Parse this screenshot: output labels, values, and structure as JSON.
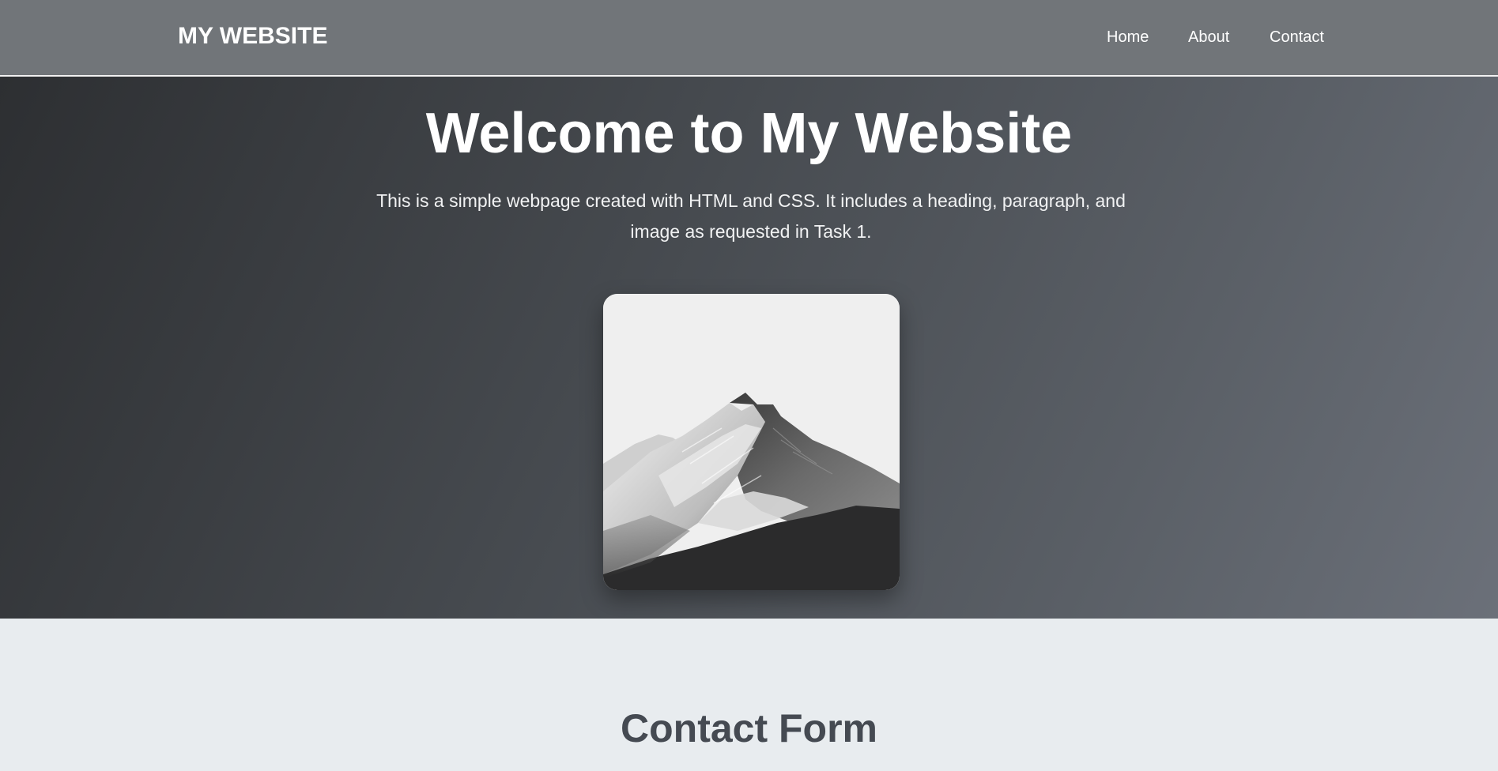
{
  "header": {
    "logo": "MY WEBSITE",
    "nav": {
      "home": "Home",
      "about": "About",
      "contact": "Contact"
    }
  },
  "hero": {
    "title": "Welcome to My Website",
    "text": "This is a simple webpage created with HTML and CSS. It includes a heading, paragraph, and image as requested in Task 1.",
    "image_icon": "mountain-landscape-image"
  },
  "contact": {
    "title": "Contact Form"
  },
  "colors": {
    "header_bg": "#717579",
    "hero_dark": "#2d2f32",
    "hero_light": "#6b7079",
    "section_bg": "#e8ecef",
    "heading_dark": "#454a52"
  }
}
